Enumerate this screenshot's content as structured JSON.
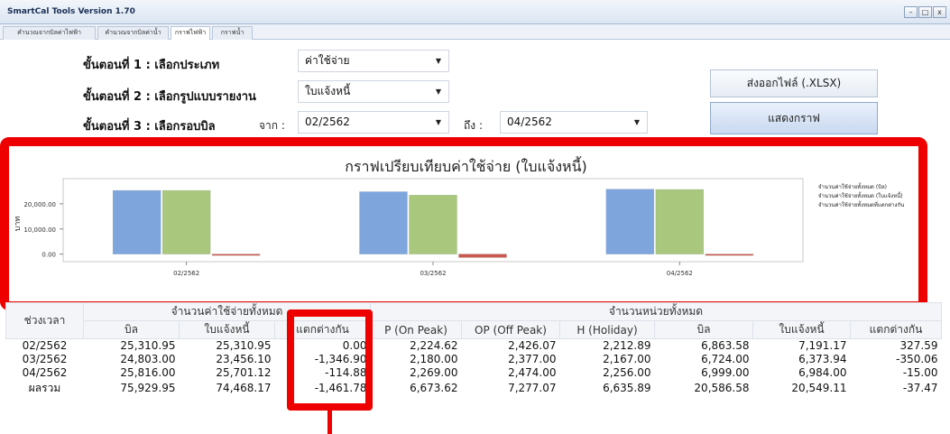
{
  "window": {
    "title": "SmartCal Tools Version 1.70",
    "buttons": [
      "–",
      "□",
      "x"
    ]
  },
  "tabs": [
    "คำนวณจากบิลค่าไฟฟ้า",
    "คำนวณจากบิลค่าน้ำ",
    "กราฟไฟฟ้า",
    "กราฟน้ำ"
  ],
  "active_tab": 2,
  "form": {
    "step1_label": "ขั้นตอนที่ 1 : เลือกประเภท",
    "step1_value": "ค่าใช้จ่าย",
    "step2_label": "ขั้นตอนที่ 2 : เลือกรูปแบบรายงาน",
    "step2_value": "ใบแจ้งหนี้",
    "step3_label": "ขั้นตอนที่ 3 : เลือกรอบบิล",
    "from_label": "จาก :",
    "from_value": "02/2562",
    "to_label": "ถึง :",
    "to_value": "04/2562",
    "export_button": "ส่งออกไฟล์ (.XLSX)",
    "show_graph_button": "แสดงกราฟ"
  },
  "chart_data": {
    "type": "bar",
    "title": "กราฟเปรียบเทียบค่าใช้จ่าย (ใบแจ้งหนี้)",
    "ylabel": "บาท",
    "categories": [
      "02/2562",
      "03/2562",
      "04/2562"
    ],
    "yticks": [
      "20,000.00",
      "10,000.00",
      "0.00"
    ],
    "ylim": [
      -3000,
      30000
    ],
    "series": [
      {
        "name": "จำนวนค่าใช้จ่ายทั้งหมด (บิล)",
        "color": "#7ea6dd",
        "values": [
          25310.95,
          24803.0,
          25816.0
        ]
      },
      {
        "name": "จำนวนค่าใช้จ่ายทั้งหมด (ใบแจ้งหนี้)",
        "color": "#aac77e",
        "values": [
          25310.95,
          23456.1,
          25701.12
        ]
      },
      {
        "name": "จำนวนค่าใช้จ่ายทั้งหมดที่แตกต่างกัน",
        "color": "#c9584f",
        "values": [
          0.0,
          -1346.9,
          -114.88
        ]
      }
    ],
    "legend": "right"
  },
  "table": {
    "period_header": "ช่วงเวลา",
    "group1_header": "จำนวนค่าใช้จ่ายทั้งหมด",
    "group2_header": "จำนวนหน่วยทั้งหมด",
    "columns": [
      "บิล",
      "ใบแจ้งหนี้",
      "แตกต่างกัน",
      "P (On Peak)",
      "OP (Off Peak)",
      "H (Holiday)",
      "บิล",
      "ใบแจ้งหนี้",
      "แตกต่างกัน"
    ],
    "rows": [
      [
        "02/2562",
        "25,310.95",
        "25,310.95",
        "0.00",
        "2,224.62",
        "2,426.07",
        "2,212.89",
        "6,863.58",
        "7,191.17",
        "327.59"
      ],
      [
        "03/2562",
        "24,803.00",
        "23,456.10",
        "-1,346.90",
        "2,180.00",
        "2,377.00",
        "2,167.00",
        "6,724.00",
        "6,373.94",
        "-350.06"
      ],
      [
        "04/2562",
        "25,816.00",
        "25,701.12",
        "-114.88",
        "2,269.00",
        "2,474.00",
        "2,256.00",
        "6,999.00",
        "6,984.00",
        "-15.00"
      ],
      [
        "ผลรวม",
        "75,929.95",
        "74,468.17",
        "-1,461.78",
        "6,673.62",
        "7,277.07",
        "6,635.89",
        "20,586.58",
        "20,549.11",
        "-37.47"
      ]
    ]
  }
}
